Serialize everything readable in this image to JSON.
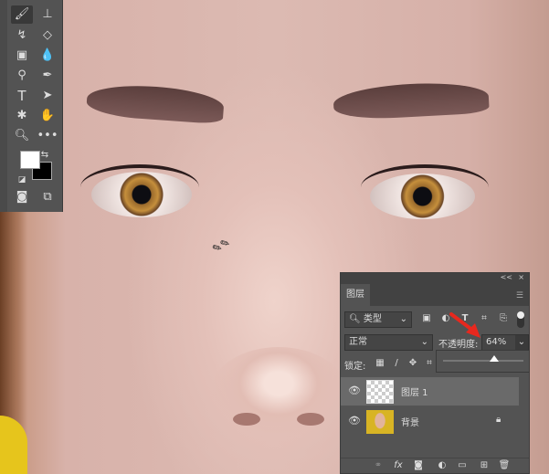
{
  "toolbar": {
    "tools": [
      "brush",
      "stamp",
      "history-brush",
      "eraser",
      "gradient",
      "blur",
      "dodge",
      "pen",
      "type",
      "path-select",
      "shape",
      "hand",
      "zoom",
      "more"
    ]
  },
  "panel": {
    "collapse": "<<",
    "close": "×",
    "tab": "图层",
    "filter": {
      "value": "类型"
    },
    "blend_mode": "正常",
    "opacity_label": "不透明度:",
    "opacity_value": "64%",
    "opacity_percent": 64,
    "lock_label": "锁定:",
    "layers": [
      {
        "name": "图层 1",
        "selected": true
      },
      {
        "name": "背景",
        "locked": true
      }
    ]
  },
  "colors": {
    "accent_arrow": "#e8281e",
    "panel_bg": "#535353"
  }
}
